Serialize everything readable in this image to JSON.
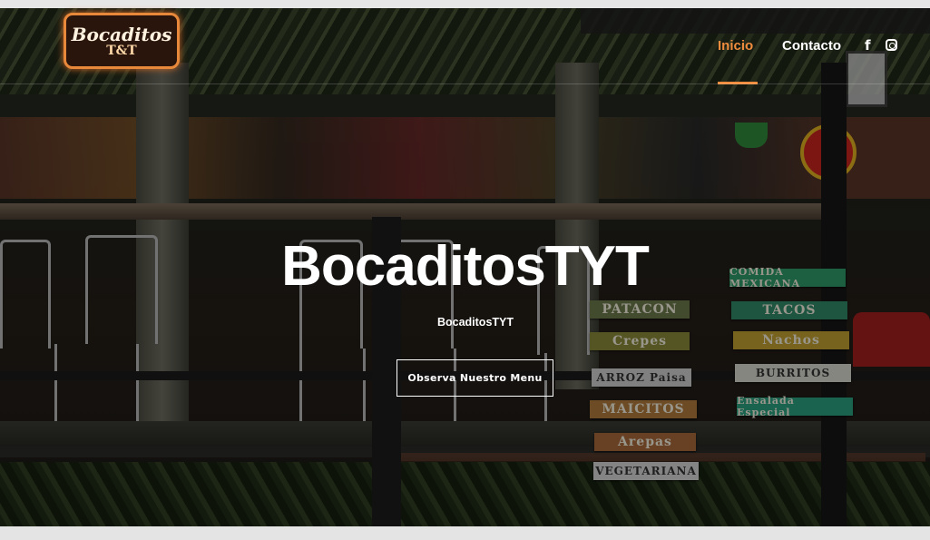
{
  "brand": {
    "logo_line1": "Bocaditos",
    "logo_line2": "T&T"
  },
  "nav": {
    "items": [
      {
        "label": "Inicio",
        "active": true
      },
      {
        "label": "Contacto",
        "active": false
      }
    ]
  },
  "social": {
    "facebook": "f",
    "facebook_icon": "facebook-icon",
    "instagram_icon": "instagram-icon"
  },
  "hero": {
    "title": "BocaditosTYT",
    "subtitle": "BocaditosTYT",
    "cta_label": "Observa Nuestro Menu"
  },
  "photo_signs": [
    {
      "text": "PATACON",
      "color": "#6b7a4a"
    },
    {
      "text": "Crepes",
      "color": "#8a8a3a"
    },
    {
      "text": "ARROZ Paisa",
      "color": "#cfcfcf"
    },
    {
      "text": "MAICITOS",
      "color": "#b07a3a"
    },
    {
      "text": "Arepas",
      "color": "#a86a3a"
    },
    {
      "text": "VEGETARIANA",
      "color": "#d6d6d6"
    },
    {
      "text": "COMIDA MEXICANA",
      "color": "#2f9a6a"
    },
    {
      "text": "TACOS",
      "color": "#2f8a6a"
    },
    {
      "text": "Nachos",
      "color": "#c0a030"
    },
    {
      "text": "BURRITOS",
      "color": "#d8d8d0"
    },
    {
      "text": "Ensalada Especial",
      "color": "#2aa080"
    }
  ],
  "colors": {
    "accent": "#ef8c3e",
    "text": "#ffffff"
  }
}
